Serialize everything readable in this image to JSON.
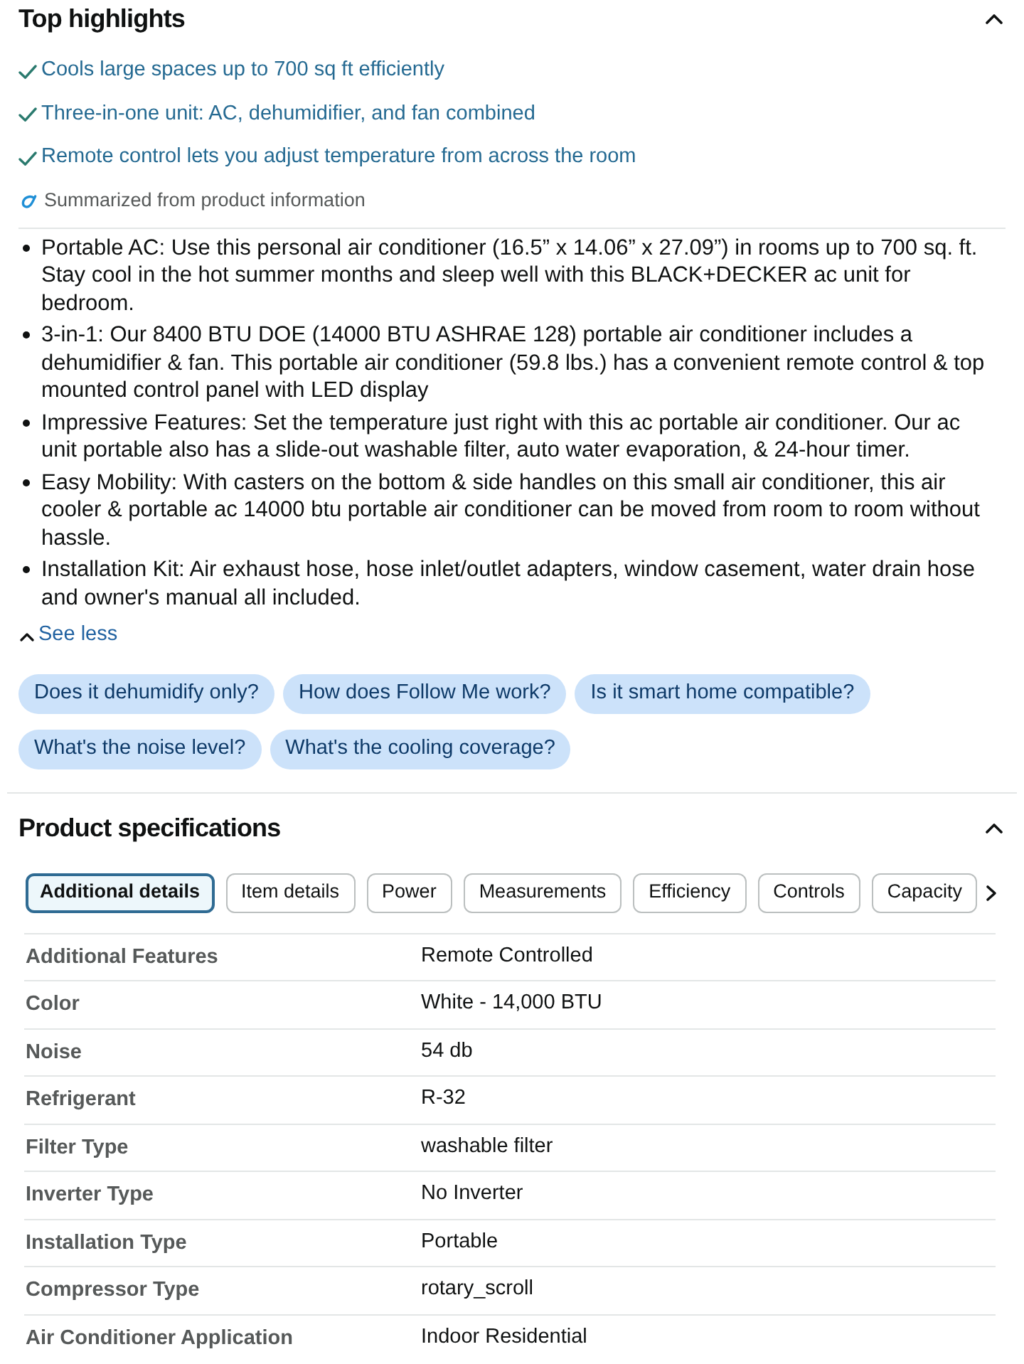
{
  "top_highlights": {
    "title": "Top highlights",
    "expanded": true,
    "items": [
      "Cools large spaces up to 700 sq ft efficiently",
      "Three-in-one unit: AC, dehumidifier, and fan combined",
      "Remote control lets you adjust temperature from across the room"
    ],
    "source_note": "Summarized from product information"
  },
  "feature_bullets": [
    "Portable AC: Use this personal air conditioner (16.5” x 14.06” x 27.09”) in rooms up to 700 sq. ft. Stay cool in the hot summer months and sleep well with this BLACK+DECKER ac unit for bedroom.",
    "3-in-1: Our 8400 BTU DOE (14000 BTU ASHRAE 128) portable air conditioner includes a dehumidifier & fan. This portable air conditioner (59.8 lbs.) has a convenient remote control & top mounted control panel with LED display",
    "Impressive Features: Set the temperature just right with this ac portable air conditioner. Our ac unit portable also has a slide-out washable filter, auto water evaporation, & 24-hour timer.",
    "Easy Mobility: With casters on the bottom & side handles on this small air conditioner, this air cooler & portable ac 14000 btu portable air conditioner can be moved from room to room without hassle.",
    "Installation Kit: Air exhaust hose, hose inlet/outlet adapters, window casement, water drain hose and owner's manual all included."
  ],
  "see_less": "See less",
  "suggested_questions": [
    "Does it dehumidify only?",
    "How does Follow Me work?",
    "Is it smart home compatible?",
    "What's the noise level?",
    "What's the cooling coverage?"
  ],
  "product_specifications": {
    "title": "Product specifications",
    "expanded": true,
    "tabs": [
      {
        "label": "Additional details",
        "selected": true
      },
      {
        "label": "Item details",
        "selected": false
      },
      {
        "label": "Power",
        "selected": false
      },
      {
        "label": "Measurements",
        "selected": false
      },
      {
        "label": "Efficiency",
        "selected": false
      },
      {
        "label": "Controls",
        "selected": false
      },
      {
        "label": "Capacity",
        "selected": false
      }
    ],
    "rows": [
      {
        "label": "Additional Features",
        "value": "Remote Controlled"
      },
      {
        "label": "Color",
        "value": "White - 14,000 BTU"
      },
      {
        "label": "Noise",
        "value": "54 db"
      },
      {
        "label": "Refrigerant",
        "value": "R-32"
      },
      {
        "label": "Filter Type",
        "value": "washable filter"
      },
      {
        "label": "Inverter Type",
        "value": "No Inverter"
      },
      {
        "label": "Installation Type",
        "value": "Portable"
      },
      {
        "label": "Compressor Type",
        "value": "rotary_scroll"
      },
      {
        "label": "Air Conditioner Application",
        "value": "Indoor Residential"
      }
    ]
  }
}
